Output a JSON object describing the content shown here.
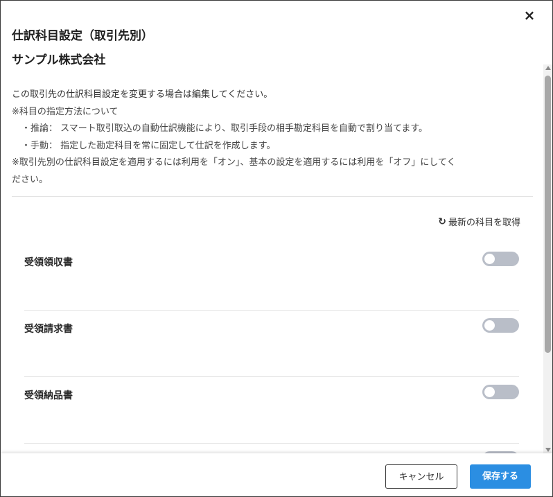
{
  "dialog": {
    "title": "仕訳科目設定（取引先別）",
    "company": "サンプル株式会社",
    "close_icon": "×"
  },
  "description": {
    "line1": "この取引先の仕訳科目設定を変更する場合は編集してください。",
    "line2": "※科目の指定方法について",
    "line3": "・推論： スマート取引取込の自動仕訳機能により、取引手段の相手勘定科目を自動で割り当てます。",
    "line4": "・手動： 指定した勘定科目を常に固定して仕訳を作成します。",
    "line5": "※取引先別の仕訳科目設定を適用するには利用を「オン」、基本の設定を適用するには利用を「オフ」にしてく",
    "line6": "ださい。"
  },
  "refresh": {
    "icon": "↻",
    "label": "最新の科目を取得"
  },
  "rows": [
    {
      "label": "受領領収書",
      "enabled": false
    },
    {
      "label": "受領請求書",
      "enabled": false
    },
    {
      "label": "受領納品書",
      "enabled": false
    }
  ],
  "footer": {
    "cancel_label": "キャンセル",
    "save_label": "保存する"
  },
  "colors": {
    "toggle_off": "#b9bec8",
    "primary": "#2b8ee2"
  }
}
